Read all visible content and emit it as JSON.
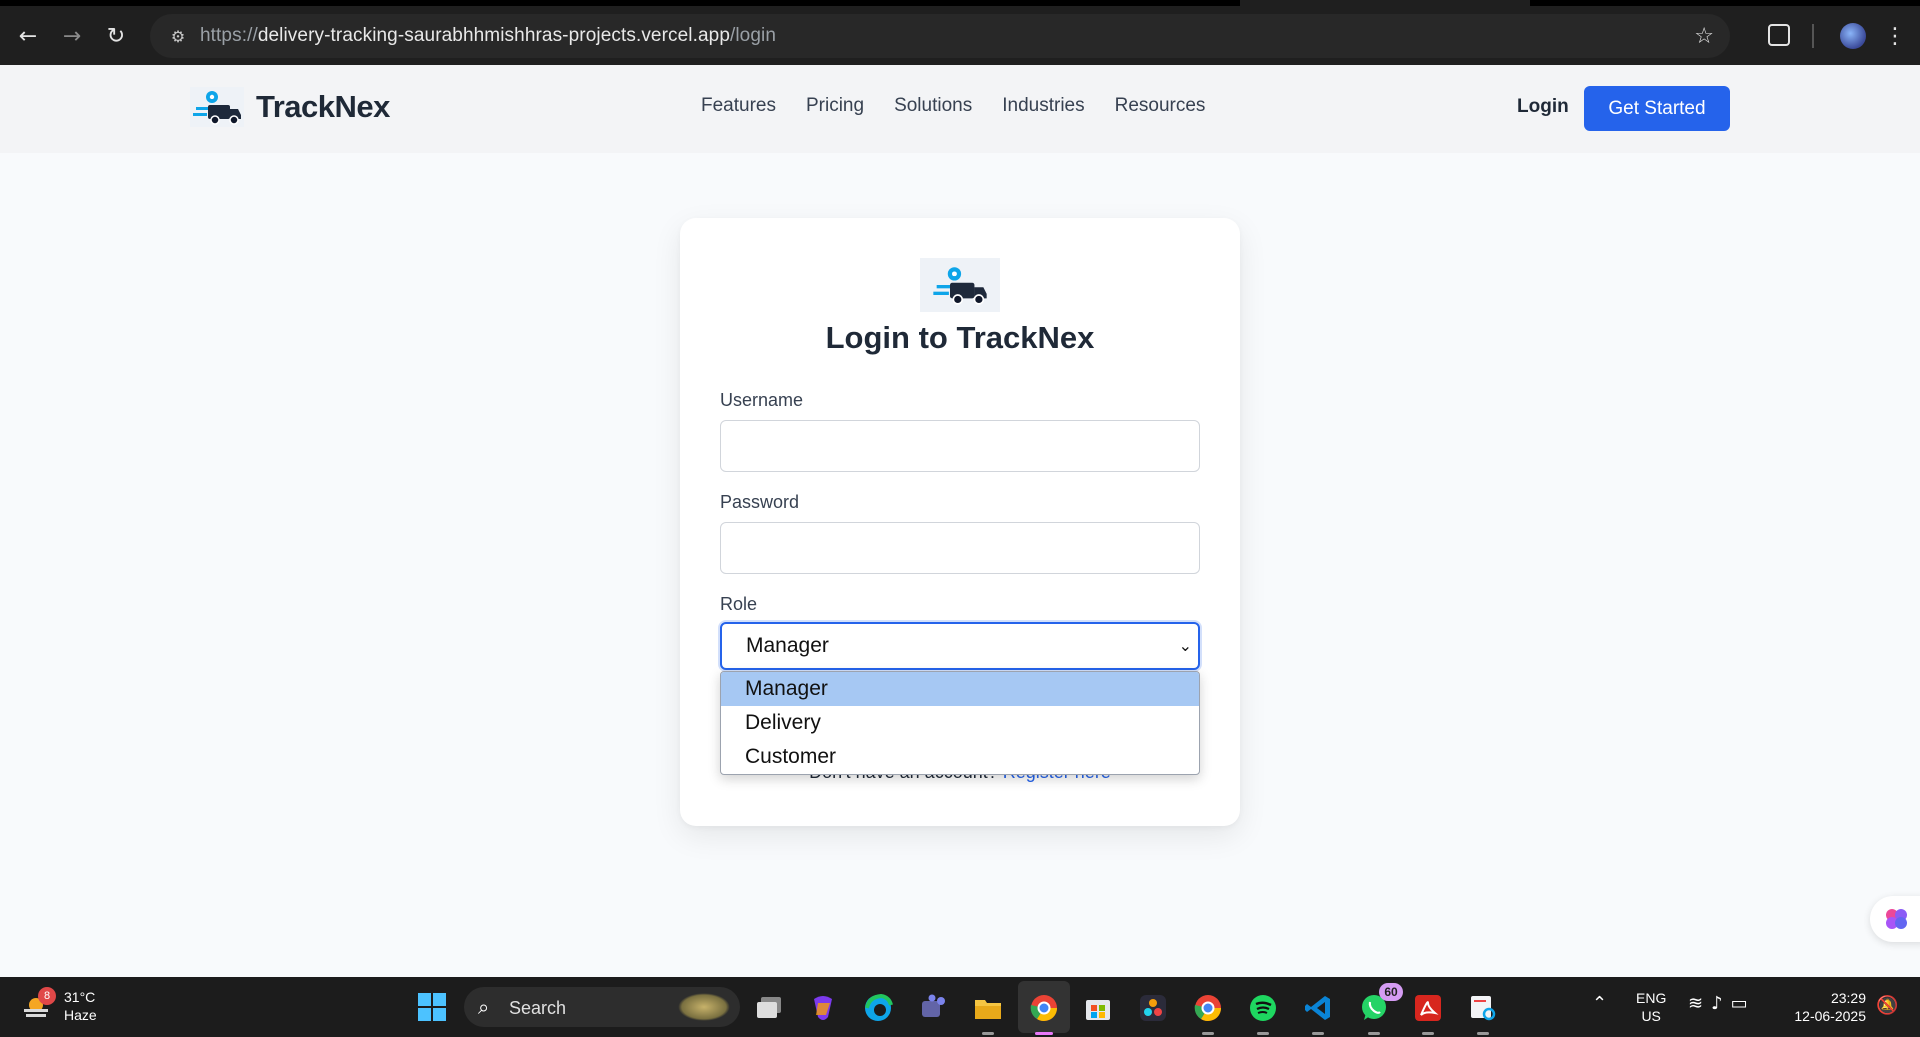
{
  "browser": {
    "url_scheme": "https://",
    "url_host": "delivery-tracking-saurabhhmishhras-projects.vercel.app",
    "url_path": "/login",
    "back_icon": "arrow-left-icon",
    "forward_icon": "arrow-right-icon",
    "reload_icon": "reload-icon",
    "bookmark_icon": "star-icon"
  },
  "header": {
    "brand": "TrackNex",
    "nav": [
      "Features",
      "Pricing",
      "Solutions",
      "Industries",
      "Resources"
    ],
    "login": "Login",
    "cta": "Get Started",
    "cta_color": "#2563eb"
  },
  "login_card": {
    "title": "Login to TrackNex",
    "username_label": "Username",
    "username_value": "",
    "password_label": "Password",
    "password_value": "",
    "role_label": "Role",
    "role_selected": "Manager",
    "role_options": [
      "Manager",
      "Delivery",
      "Customer"
    ],
    "register_prompt": "Don't have an account?",
    "register_link": "Register here"
  },
  "taskbar": {
    "weather_temp": "31°C",
    "weather_cond": "Haze",
    "weather_badge": "8",
    "search_placeholder": "Search",
    "whatsapp_badge": "60",
    "lang_line1": "ENG",
    "lang_line2": "US",
    "time": "23:29",
    "date": "12-06-2025"
  }
}
